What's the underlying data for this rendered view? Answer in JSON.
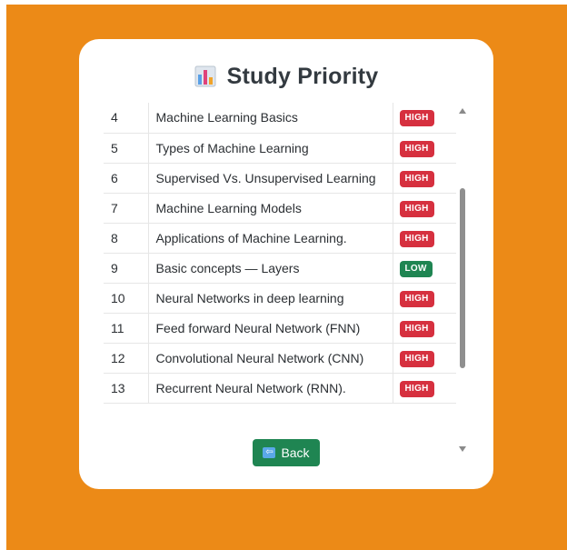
{
  "page": {
    "title": "Study Priority",
    "title_icon": "bar-chart-icon",
    "accent_color": "#ec8a17"
  },
  "table": {
    "rows": [
      {
        "num": "4",
        "topic": "Machine Learning Basics",
        "priority": "HIGH"
      },
      {
        "num": "5",
        "topic": "Types of Machine Learning",
        "priority": "HIGH"
      },
      {
        "num": "6",
        "topic": "Supervised Vs. Unsupervised Learning",
        "priority": "HIGH"
      },
      {
        "num": "7",
        "topic": "Machine Learning Models",
        "priority": "HIGH"
      },
      {
        "num": "8",
        "topic": "Applications of Machine Learning.",
        "priority": "HIGH"
      },
      {
        "num": "9",
        "topic": "Basic concepts — Layers",
        "priority": "LOW"
      },
      {
        "num": "10",
        "topic": "Neural Networks in deep learning",
        "priority": "HIGH"
      },
      {
        "num": "11",
        "topic": "Feed forward Neural Network (FNN)",
        "priority": "HIGH"
      },
      {
        "num": "12",
        "topic": "Convolutional Neural Network (CNN)",
        "priority": "HIGH"
      },
      {
        "num": "13",
        "topic": "Recurrent Neural Network (RNN).",
        "priority": "HIGH"
      }
    ],
    "badge_colors": {
      "HIGH": "#d6303f",
      "LOW": "#1f8552"
    }
  },
  "footer": {
    "back_label": "Back",
    "back_icon": "back-arrow-icon"
  }
}
